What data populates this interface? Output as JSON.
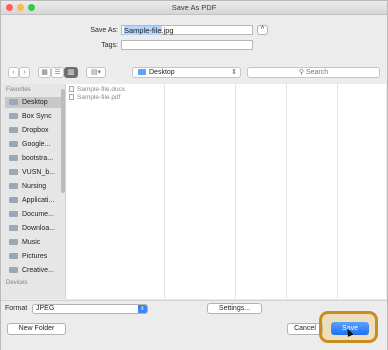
{
  "window": {
    "title": "Save As PDF"
  },
  "header": {
    "save_as_label": "Save As:",
    "save_as_selected": "Sample-file",
    "save_as_rest": ".jpg",
    "tags_label": "Tags:",
    "tags_value": ""
  },
  "toolbar": {
    "location": "Desktop",
    "search_placeholder": "Search"
  },
  "sidebar": {
    "favorites_header": "Favorites",
    "items": [
      {
        "label": "Desktop",
        "icon": "desktop-icon"
      },
      {
        "label": "Box Sync",
        "icon": "box-icon"
      },
      {
        "label": "Dropbox",
        "icon": "dropbox-icon"
      },
      {
        "label": "Google...",
        "icon": "folder-icon"
      },
      {
        "label": "bootstra...",
        "icon": "folder-icon"
      },
      {
        "label": "VUSN_b...",
        "icon": "folder-icon"
      },
      {
        "label": "Nursing",
        "icon": "folder-icon"
      },
      {
        "label": "Applicati...",
        "icon": "applications-icon"
      },
      {
        "label": "Docume...",
        "icon": "documents-icon"
      },
      {
        "label": "Downloa...",
        "icon": "downloads-icon"
      },
      {
        "label": "Music",
        "icon": "music-icon"
      },
      {
        "label": "Pictures",
        "icon": "pictures-icon"
      },
      {
        "label": "Creative...",
        "icon": "folder-icon"
      }
    ],
    "devices_header": "Devices"
  },
  "files": [
    {
      "name": "Sample-file.docx"
    },
    {
      "name": "Sample-file.pdf"
    }
  ],
  "bottom": {
    "format_label": "Format",
    "format_value": "JPEG",
    "settings_label": "Settings...",
    "new_folder_label": "New Folder",
    "cancel_label": "Cancel",
    "save_label": "Save"
  },
  "colors": {
    "accent": "#1f6fef",
    "highlight": "#c98c1e"
  }
}
